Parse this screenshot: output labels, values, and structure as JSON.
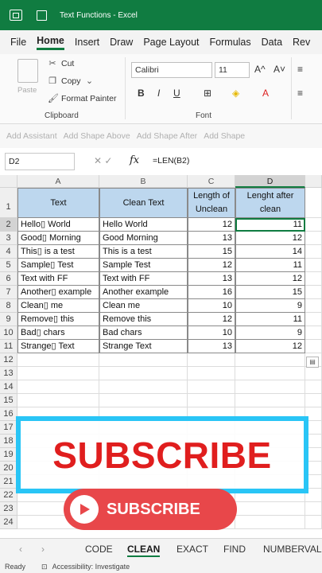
{
  "titlebar": {
    "title": "Text Functions  -  Excel"
  },
  "menu": [
    "File",
    "Home",
    "Insert",
    "Draw",
    "Page Layout",
    "Formulas",
    "Data",
    "Rev"
  ],
  "menu_active": "Home",
  "ribbon": {
    "paste_label": "Paste",
    "cut": "Cut",
    "copy": "Copy",
    "format_painter": "Format Painter",
    "clipboard_label": "Clipboard",
    "font_name": "Calibri",
    "font_size": "11",
    "font_label": "Font",
    "grow": "A^",
    "shrink": "A˅",
    "bold": "B",
    "italic": "I",
    "underline": "U"
  },
  "smartart": [
    "Add Assistant",
    "Add Shape Above",
    "Add Shape After",
    "Add Shape"
  ],
  "formulabar": {
    "namebox": "D2",
    "fx": "fx",
    "formula": "=LEN(B2)"
  },
  "columns": [
    "A",
    "B",
    "C",
    "D"
  ],
  "header_row": {
    "a": "Text",
    "b": "Clean Text",
    "c": "Length of Unclean",
    "d": "Lenght after clean"
  },
  "rows": [
    {
      "a": "Hello▯ World",
      "b": "Hello World",
      "c": "12",
      "d": "11"
    },
    {
      "a": "Good▯ Morning",
      "b": "Good Morning",
      "c": "13",
      "d": "12"
    },
    {
      "a": "This▯ is a test",
      "b": "This is a test",
      "c": "15",
      "d": "14"
    },
    {
      "a": "Sample▯ Test",
      "b": "Sample Test",
      "c": "12",
      "d": "11"
    },
    {
      "a": "Text with FF",
      "b": "Text with FF",
      "c": "13",
      "d": "12"
    },
    {
      "a": "Another▯ example",
      "b": "Another example",
      "c": "16",
      "d": "15"
    },
    {
      "a": "Clean▯ me",
      "b": "Clean  me",
      "c": "10",
      "d": "9"
    },
    {
      "a": "Remove▯ this",
      "b": "Remove this",
      "c": "12",
      "d": "11"
    },
    {
      "a": "Bad▯ chars",
      "b": "Bad chars",
      "c": "10",
      "d": "9"
    },
    {
      "a": "Strange▯ Text",
      "b": "Strange Text",
      "c": "13",
      "d": "12"
    }
  ],
  "row_numbers": [
    "1",
    "2",
    "3",
    "4",
    "5",
    "6",
    "7",
    "8",
    "9",
    "10",
    "11",
    "12",
    "13",
    "14",
    "15",
    "16",
    "17",
    "18",
    "19",
    "20",
    "21",
    "22",
    "23",
    "24"
  ],
  "overlay": {
    "subscribe_big": "SUBSCRIBE",
    "subscribe_btn": "SUBSCRIBE"
  },
  "sheets": [
    "CODE",
    "CLEAN",
    "EXACT",
    "FIND",
    "NUMBERVALUE"
  ],
  "active_sheet": "CLEAN",
  "status": {
    "ready": "Ready",
    "accessibility": "Accessibility: Investigate"
  },
  "colors": {
    "excel_green": "#107c41",
    "header_fill": "#bdd7ee",
    "subscribe_red": "#e01e1e",
    "frame_blue": "#29c5f6"
  }
}
